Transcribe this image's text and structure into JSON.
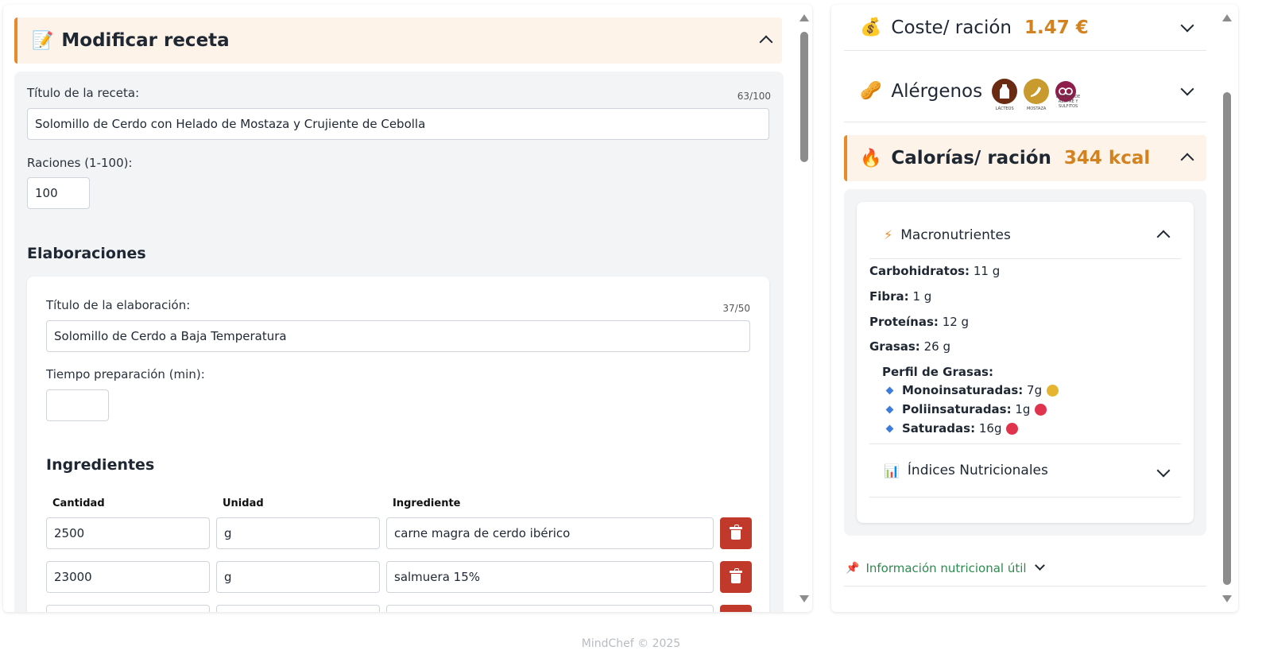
{
  "recipe": {
    "header_icon": "📝",
    "header_title": "Modificar receta",
    "title_label": "Título de la receta:",
    "title_counter": "63/100",
    "title_value": "Solomillo de Cerdo con Helado de Mostaza y Crujiente de Cebolla",
    "servings_label": "Raciones (1-100):",
    "servings_value": "100",
    "elaborations_title": "Elaboraciones"
  },
  "elaboration": {
    "title_label": "Título de la elaboración:",
    "title_counter": "37/50",
    "title_value": "Solomillo de Cerdo a Baja Temperatura",
    "time_label": "Tiempo preparación (min):",
    "time_value": "",
    "ingredients_title": "Ingredientes",
    "columns": [
      "Cantidad",
      "Unidad",
      "Ingrediente"
    ],
    "ingredients": [
      {
        "quantity": "2500",
        "unit": "g",
        "name": "carne magra de cerdo ibérico"
      },
      {
        "quantity": "23000",
        "unit": "g",
        "name": "salmuera 15%"
      },
      {
        "quantity": "",
        "unit": "",
        "name": ""
      }
    ]
  },
  "summary": {
    "cost": {
      "icon": "💰",
      "label": "Coste/ ración",
      "value": "1.47 €"
    },
    "allergens": {
      "icon": "🥜",
      "label": "Alérgenos",
      "items": [
        {
          "icon": "milk-allergen-icon",
          "caption": "LÁCTEOS",
          "color": "#6b2a12"
        },
        {
          "icon": "mustard-allergen-icon",
          "caption": "MOSTAZA",
          "color": "#c99a2e"
        },
        {
          "icon": "sulphites-allergen-icon",
          "caption": "DIÓXIDO DE AZUFRE Y SULFITOS",
          "color": "#8e1f4c"
        }
      ]
    },
    "calories": {
      "icon": "🔥",
      "label": "Calorías/ ración",
      "value": "344 kcal"
    },
    "macros": {
      "icon": "⚡",
      "title": "Macronutrientes",
      "carbs_label": "Carbohidratos:",
      "carbs_value": "11 g",
      "fiber_label": "Fibra:",
      "fiber_value": "1 g",
      "protein_label": "Proteínas:",
      "protein_value": "12 g",
      "fat_label": "Grasas:",
      "fat_value": "26 g",
      "fat_profile_title": "Perfil de Grasas:",
      "fat_profile": [
        {
          "label": "Monoinsaturadas:",
          "value": "7g",
          "color": "#e5b530"
        },
        {
          "label": "Poliinsaturadas:",
          "value": "1g",
          "color": "#e0334d"
        },
        {
          "label": "Saturadas:",
          "value": "16g",
          "color": "#e0334d"
        }
      ]
    },
    "indices": {
      "icon": "📊",
      "title": "Índices Nutricionales"
    },
    "info": {
      "icon": "📌",
      "text": "Información nutricional útil"
    }
  },
  "footer": {
    "text": "MindChef © 2025"
  },
  "colors": {
    "accent": "#e98a2a",
    "value_orange": "#d2821f",
    "delete_red": "#c0392b",
    "info_green": "#2d8a4e"
  }
}
